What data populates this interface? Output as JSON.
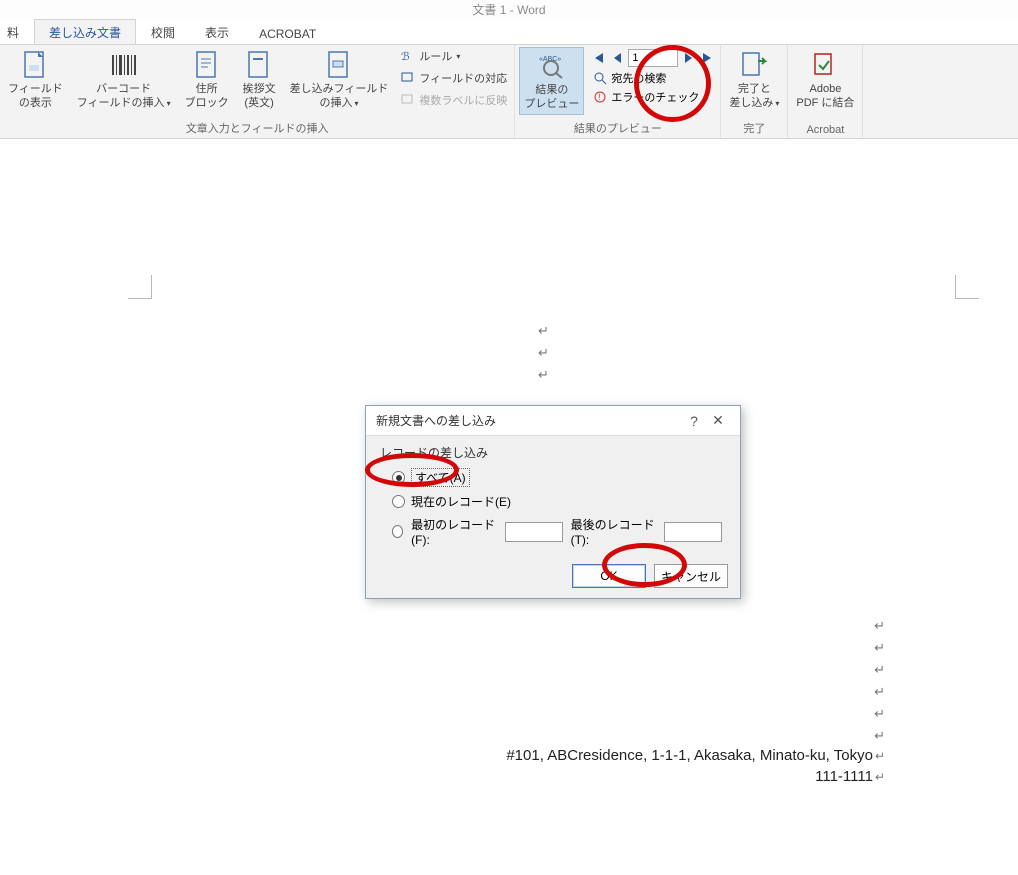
{
  "title": "文書 1 - Word",
  "tabs": {
    "t0": "料",
    "t1": "差し込み文書",
    "t2": "校閲",
    "t3": "表示",
    "t4": "ACROBAT"
  },
  "ribbon": {
    "field_display_l1": "フィールド",
    "field_display_l2": "の表示",
    "barcode_l1": "バーコード",
    "barcode_l2": "フィールドの挿入",
    "address_l1": "住所",
    "address_l2": "ブロック",
    "greeting_l1": "挨拶文",
    "greeting_l2": "(英文)",
    "merge_field_l1": "差し込みフィールド",
    "merge_field_l2": "の挿入",
    "rules": "ルール",
    "match_fields": "フィールドの対応",
    "update_labels": "複数ラベルに反映",
    "preview_l1": "結果の",
    "preview_l2": "プレビュー",
    "record_value": "1",
    "find_recipient": "宛先の検索",
    "error_check": "エラーのチェック",
    "finish_l1": "完了と",
    "finish_l2": "差し込み",
    "pdf_l1": "Adobe",
    "pdf_l2": "PDF に結合",
    "group1": "文章入力とフィールドの挿入",
    "group2": "結果のプレビュー",
    "group3": "完了",
    "group4": "Acrobat"
  },
  "dialog": {
    "title": "新規文書への差し込み",
    "group": "レコードの差し込み",
    "all": "すべて(A)",
    "current": "現在のレコード(E)",
    "from": "最初のレコード(F):",
    "to": "最後のレコード(T):",
    "ok": "OK",
    "cancel": "キャンセル"
  },
  "document": {
    "address_line1": "#101, ABCresidence, 1-1-1, Akasaka, Minato-ku, Tokyo",
    "address_line2": "111-1111"
  }
}
